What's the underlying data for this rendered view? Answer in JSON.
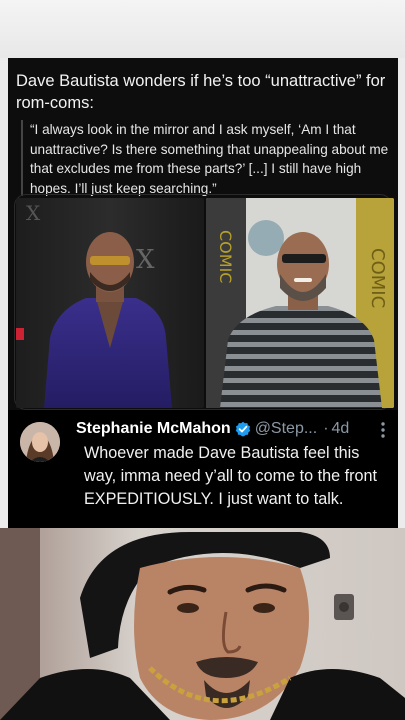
{
  "card": {
    "headline": "Dave Bautista wonders if he’s too “unattractive” for rom-coms:",
    "quote": "“I always look in the mirror and I ask myself, ‘Am I that unattractive? Is there something that unappealing about me that excludes me from these parts?’ [...] I still have high hopes. I’ll just keep searching.”"
  },
  "tweet": {
    "author": "Stephanie McMahon",
    "handle": "@Step...",
    "separator": "·",
    "time": "4d",
    "text": "Whoever made Dave Bautista feel this way, imma need y’all to come to the front EXPEDITIOUSLY. I just want to talk."
  },
  "colors": {
    "card_bg": "#0d0d0d",
    "verified": "#1d9bf0",
    "muted": "#8b98a5"
  },
  "icons": [
    "verified-badge-icon",
    "more-options-icon"
  ]
}
